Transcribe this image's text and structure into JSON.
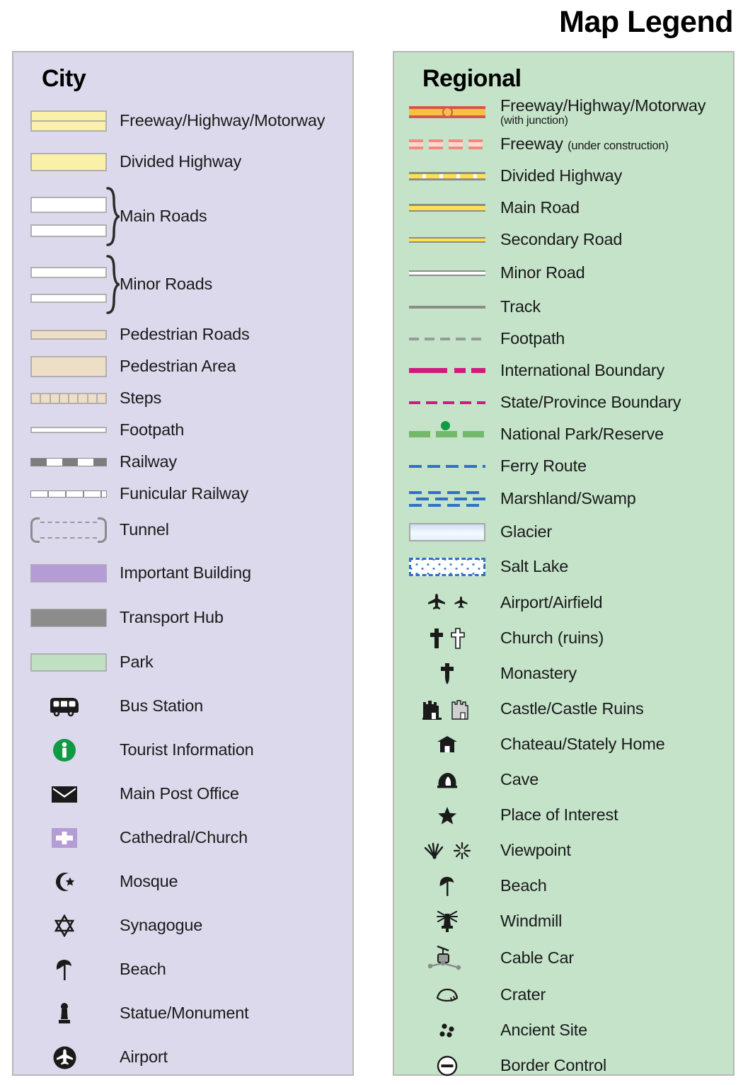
{
  "title": "Map Legend",
  "panels": {
    "city": {
      "heading": "City",
      "bg_color": "#ddd9ec",
      "items": [
        {
          "label": "Freeway/Highway/Motorway",
          "symbol": "city-freeway-swatch"
        },
        {
          "label": "Divided Highway",
          "symbol": "city-divided-highway-swatch"
        },
        {
          "label": "Main Roads",
          "symbol": "city-main-roads-brace-swatch"
        },
        {
          "label": "Minor Roads",
          "symbol": "city-minor-roads-brace-swatch"
        },
        {
          "label": "Pedestrian Roads",
          "symbol": "city-pedestrian-road-swatch"
        },
        {
          "label": "Pedestrian Area",
          "symbol": "city-pedestrian-area-swatch"
        },
        {
          "label": "Steps",
          "symbol": "city-steps-swatch"
        },
        {
          "label": "Footpath",
          "symbol": "city-footpath-swatch"
        },
        {
          "label": "Railway",
          "symbol": "city-railway-swatch"
        },
        {
          "label": "Funicular Railway",
          "symbol": "city-funicular-railway-swatch"
        },
        {
          "label": "Tunnel",
          "symbol": "city-tunnel-swatch"
        },
        {
          "label": "Important Building",
          "symbol": "city-important-building-swatch"
        },
        {
          "label": "Transport Hub",
          "symbol": "city-transport-hub-swatch"
        },
        {
          "label": "Park",
          "symbol": "city-park-swatch"
        },
        {
          "label": "Bus Station",
          "symbol": "bus-icon"
        },
        {
          "label": "Tourist Information",
          "symbol": "information-icon"
        },
        {
          "label": "Main Post Office",
          "symbol": "envelope-icon"
        },
        {
          "label": "Cathedral/Church",
          "symbol": "church-cross-icon"
        },
        {
          "label": "Mosque",
          "symbol": "crescent-star-icon"
        },
        {
          "label": "Synagogue",
          "symbol": "star-of-david-icon"
        },
        {
          "label": "Beach",
          "symbol": "beach-umbrella-icon"
        },
        {
          "label": "Statue/Monument",
          "symbol": "statue-icon"
        },
        {
          "label": "Airport",
          "symbol": "airplane-circle-icon"
        }
      ]
    },
    "regional": {
      "heading": "Regional",
      "bg_color": "#c4e3c9",
      "items": [
        {
          "label": "Freeway/Highway/Motorway",
          "sublabel": "(with junction)",
          "sub_style": "below",
          "symbol": "regional-freeway-junction-swatch"
        },
        {
          "label": "Freeway",
          "sublabel": "(under construction)",
          "sub_style": "inline",
          "symbol": "regional-freeway-under-construction-swatch"
        },
        {
          "label": "Divided Highway",
          "symbol": "regional-divided-highway-swatch"
        },
        {
          "label": "Main Road",
          "symbol": "regional-main-road-swatch"
        },
        {
          "label": "Secondary Road",
          "symbol": "regional-secondary-road-swatch"
        },
        {
          "label": "Minor Road",
          "symbol": "regional-minor-road-swatch"
        },
        {
          "label": "Track",
          "symbol": "regional-track-swatch"
        },
        {
          "label": "Footpath",
          "symbol": "regional-footpath-swatch"
        },
        {
          "label": "International Boundary",
          "symbol": "international-boundary-swatch"
        },
        {
          "label": "State/Province Boundary",
          "symbol": "state-boundary-swatch"
        },
        {
          "label": "National Park/Reserve",
          "symbol": "national-park-swatch"
        },
        {
          "label": "Ferry Route",
          "symbol": "ferry-route-swatch"
        },
        {
          "label": "Marshland/Swamp",
          "symbol": "marshland-swatch"
        },
        {
          "label": "Glacier",
          "symbol": "glacier-swatch"
        },
        {
          "label": "Salt Lake",
          "symbol": "salt-lake-swatch"
        },
        {
          "label": "Airport/Airfield",
          "symbol": "airplane-pair-icon"
        },
        {
          "label": "Church (ruins)",
          "symbol": "cross-pair-icon"
        },
        {
          "label": "Monastery",
          "symbol": "monastery-cross-icon"
        },
        {
          "label": "Castle/Castle Ruins",
          "symbol": "castle-pair-icon"
        },
        {
          "label": "Chateau/Stately Home",
          "symbol": "chateau-icon"
        },
        {
          "label": "Cave",
          "symbol": "cave-icon"
        },
        {
          "label": "Place of Interest",
          "symbol": "star-icon"
        },
        {
          "label": "Viewpoint",
          "symbol": "viewpoint-pair-icon"
        },
        {
          "label": "Beach",
          "symbol": "beach-umbrella-icon"
        },
        {
          "label": "Windmill",
          "symbol": "windmill-icon"
        },
        {
          "label": "Cable Car",
          "symbol": "cable-car-icon"
        },
        {
          "label": "Crater",
          "symbol": "crater-icon"
        },
        {
          "label": "Ancient Site",
          "symbol": "ancient-site-icon"
        },
        {
          "label": "Border Control",
          "symbol": "border-control-icon"
        }
      ]
    }
  },
  "colors": {
    "city_panel": "#ddd9ec",
    "regional_panel": "#c4e3c9",
    "highway_yellow": "#fbf0a8",
    "pedestrian_tan": "#eddfc5",
    "important_building_purple": "#b49cd4",
    "transport_hub_gray": "#8c8c8c",
    "park_green": "#bfe0c1",
    "freeway_red": "#d9534f",
    "freeway_fill": "#f5c246",
    "road_yellow": "#ffe14d",
    "boundary_magenta": "#d2197e",
    "ferry_blue": "#2d72c7",
    "national_park_green": "#74b86a",
    "tourist_info_green": "#119944"
  }
}
